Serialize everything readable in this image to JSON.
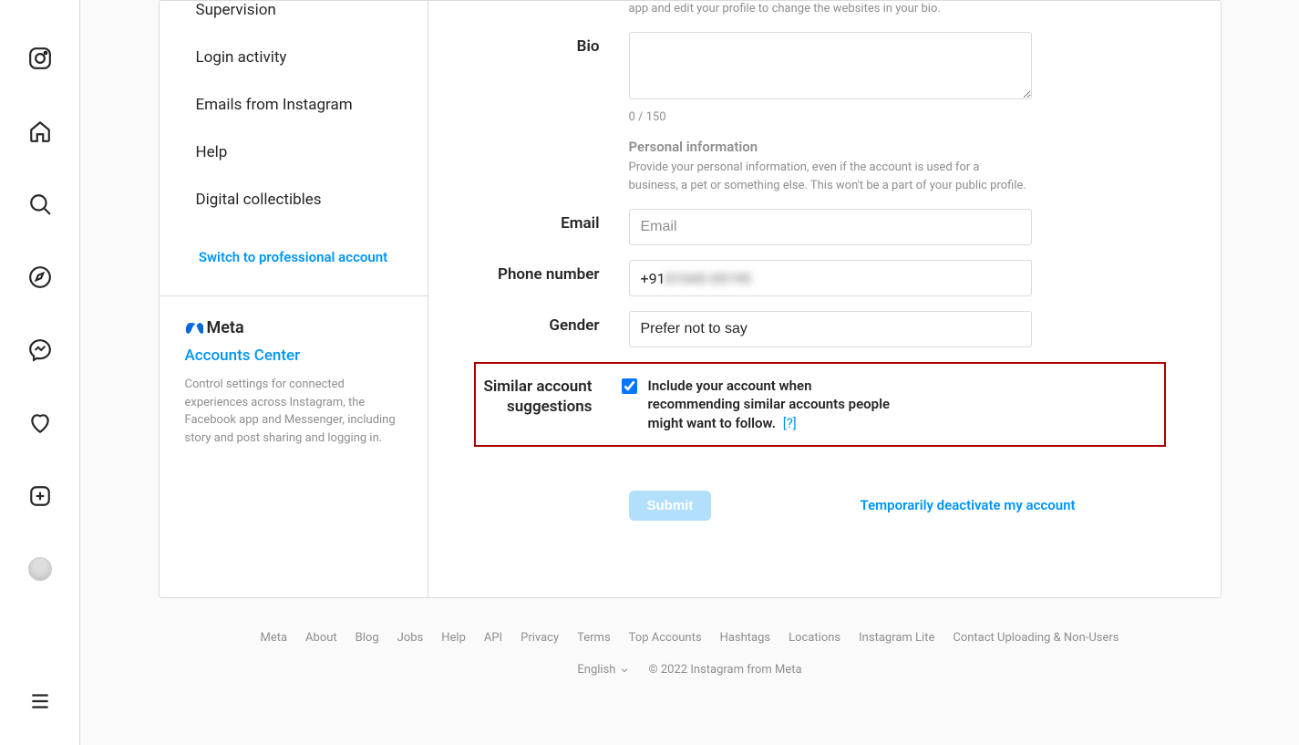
{
  "nav": {
    "sidebar_items": {
      "supervision": "Supervision",
      "login_activity": "Login activity",
      "emails": "Emails from Instagram",
      "help": "Help",
      "digital_collectibles": "Digital collectibles"
    },
    "switch_professional": "Switch to professional account",
    "meta_label": "Meta",
    "accounts_center": "Accounts Center",
    "accounts_center_desc": "Control settings for connected experiences across Instagram, the Facebook app and Messenger, including story and post sharing and logging in."
  },
  "form": {
    "website_hint_partial": "app and edit your profile to change the websites in your bio.",
    "bio_label": "Bio",
    "bio_value": "",
    "bio_count": "0 / 150",
    "personal_info_heading": "Personal information",
    "personal_info_desc": "Provide your personal information, even if the account is used for a business, a pet or something else. This won't be a part of your public profile.",
    "email_label": "Email",
    "email_placeholder": "Email",
    "email_value": "",
    "phone_label": "Phone number",
    "phone_prefix": "+91 ",
    "phone_blurred": "01045 05195",
    "gender_label": "Gender",
    "gender_value": "Prefer not to say",
    "similar_label_l1": "Similar account",
    "similar_label_l2": "suggestions",
    "similar_checkbox_label": "Include your account when recommending similar accounts people might want to follow.",
    "similar_help": "[?]",
    "submit": "Submit",
    "deactivate": "Temporarily deactivate my account"
  },
  "footer": {
    "links": [
      "Meta",
      "About",
      "Blog",
      "Jobs",
      "Help",
      "API",
      "Privacy",
      "Terms",
      "Top Accounts",
      "Hashtags",
      "Locations",
      "Instagram Lite",
      "Contact Uploading & Non-Users"
    ],
    "language": "English",
    "copyright": "© 2022 Instagram from Meta"
  }
}
